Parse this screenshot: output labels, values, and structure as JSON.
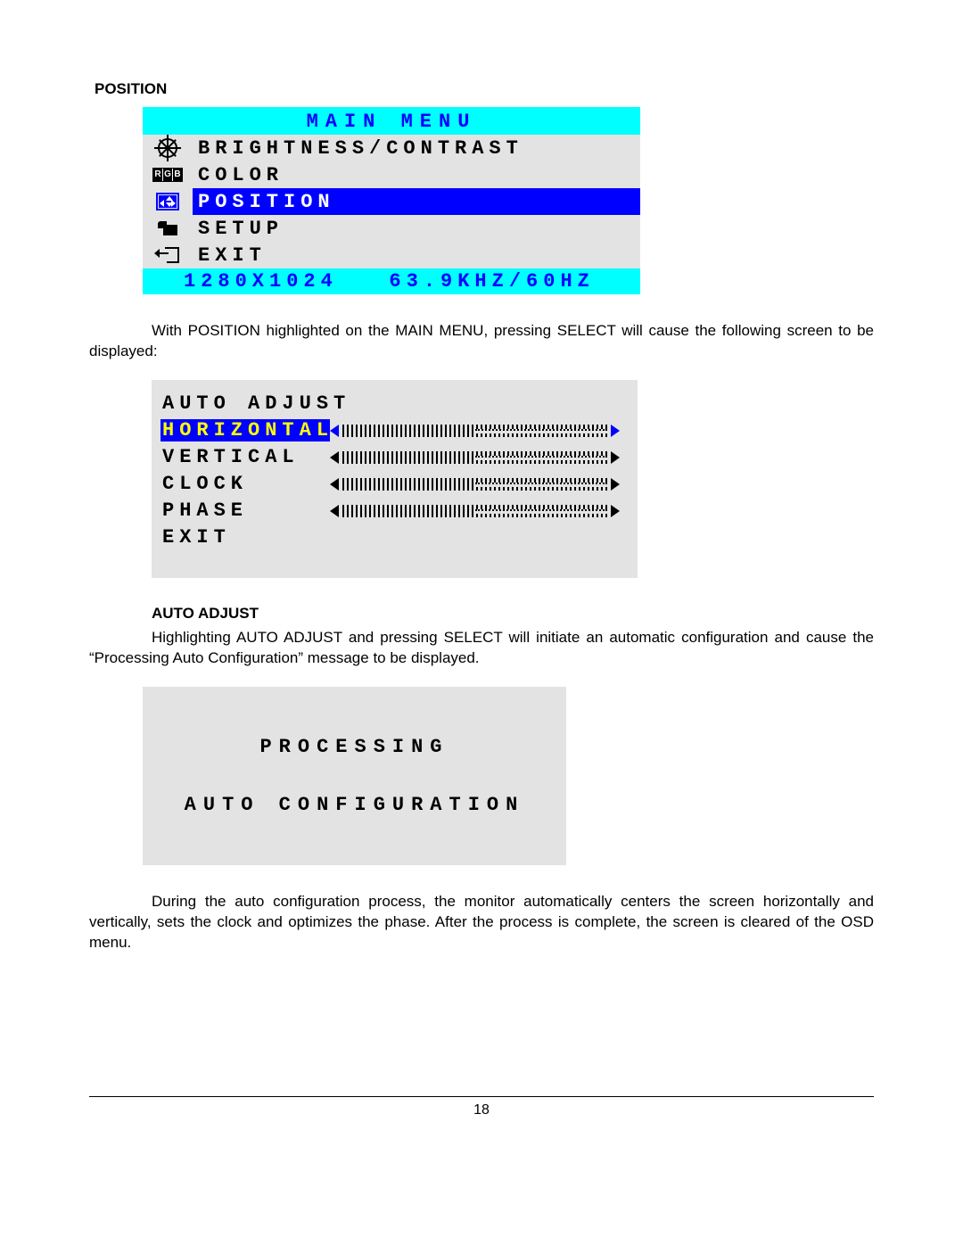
{
  "section_heading_position": "POSITION",
  "main_menu": {
    "title": "MAIN  MENU",
    "items": [
      {
        "label": "BRIGHTNESS/CONTRAST",
        "selected": false,
        "icon": "brightness-icon"
      },
      {
        "label": "COLOR",
        "selected": false,
        "icon": "rgb-icon"
      },
      {
        "label": "POSITION",
        "selected": true,
        "icon": "position-icon"
      },
      {
        "label": "SETUP",
        "selected": false,
        "icon": "setup-icon"
      },
      {
        "label": "EXIT",
        "selected": false,
        "icon": "exit-icon"
      }
    ],
    "status": "1280X1024   63.9KHZ/60HZ"
  },
  "para1": "With POSITION highlighted on the MAIN MENU, pressing SELECT will cause the following screen to be displayed:",
  "submenu": {
    "items": [
      {
        "label": "AUTO ADJUST",
        "slider": false,
        "selected": false
      },
      {
        "label": "HORIZONTAL",
        "slider": true,
        "selected": true,
        "value_percent": 50
      },
      {
        "label": "VERTICAL",
        "slider": true,
        "selected": false,
        "value_percent": 50
      },
      {
        "label": "CLOCK",
        "slider": true,
        "selected": false,
        "value_percent": 50
      },
      {
        "label": "PHASE",
        "slider": true,
        "selected": false,
        "value_percent": 50
      },
      {
        "label": "EXIT",
        "slider": false,
        "selected": false
      }
    ]
  },
  "section_heading_auto": "AUTO ADJUST",
  "para2": "Highlighting AUTO ADJUST and pressing SELECT will initiate an automatic configuration and cause the “Processing Auto Configuration” message to be displayed.",
  "processing": {
    "line1": "PROCESSING",
    "line2": "AUTO CONFIGURATION"
  },
  "para3": "During the auto configuration process, the monitor automatically centers the screen horizontally and vertically, sets the clock and optimizes the phase. After the process is complete, the screen is cleared of the OSD menu.",
  "page_number": "18"
}
